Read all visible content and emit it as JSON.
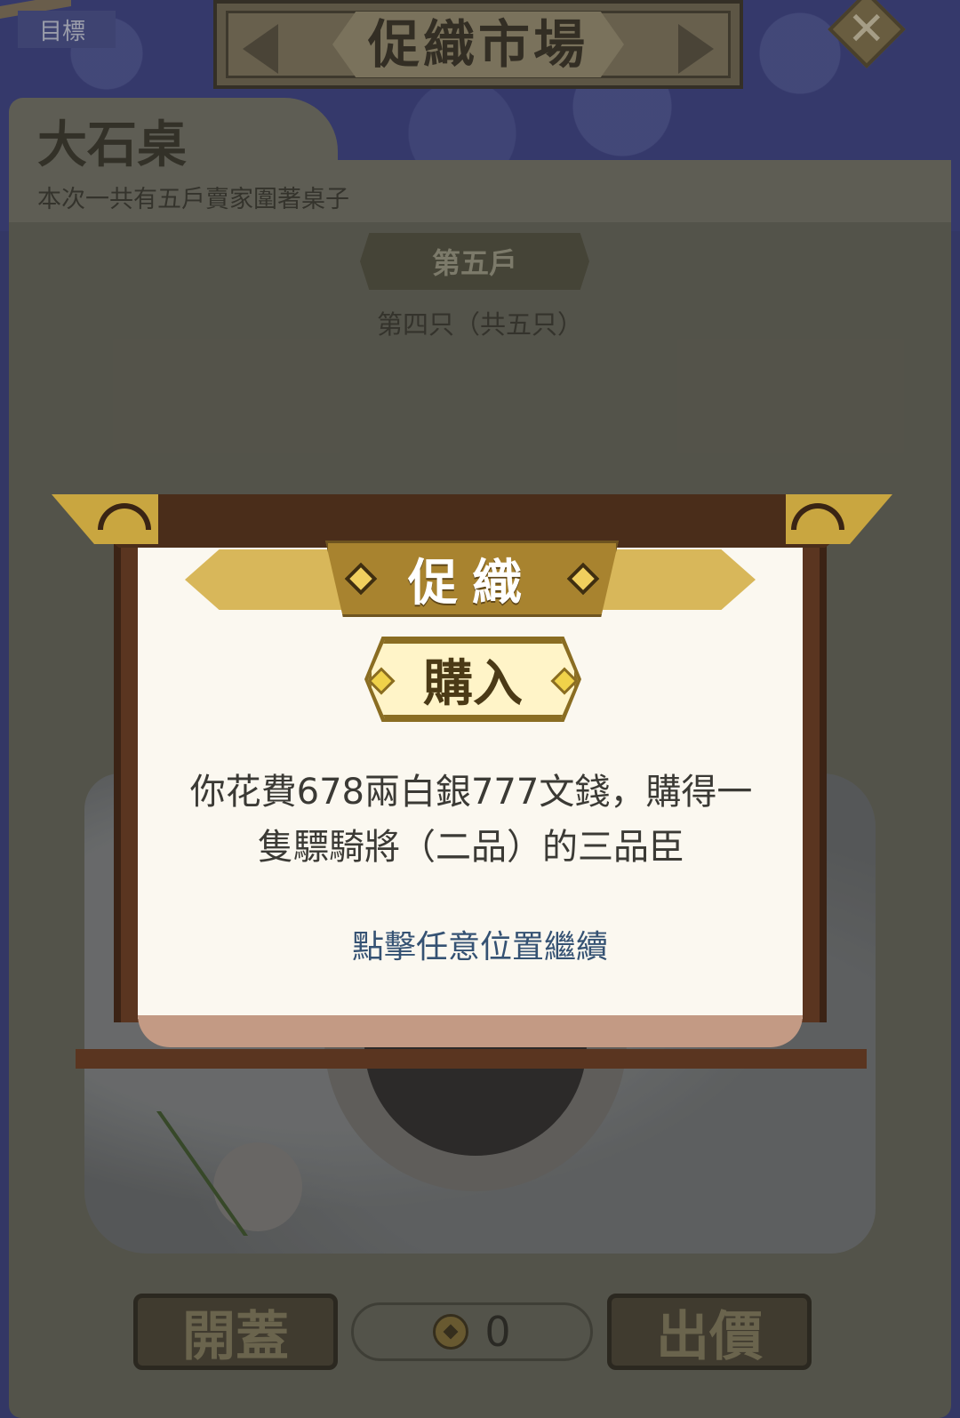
{
  "header": {
    "target_tab": "目標",
    "title": "促織市場",
    "close_glyph": "✕"
  },
  "table": {
    "name": "大石桌",
    "description": "本次一共有五戶賣家圍著桌子",
    "seller": "第五戶",
    "item_index": "第四只（共五只）"
  },
  "modal": {
    "ribbon_title": "促織",
    "result_label": "購入",
    "message_line1": "你花費678兩白銀777文錢，購得一",
    "message_line2": "隻驃騎將（二品）的三品臣",
    "continue_hint": "點擊任意位置繼續"
  },
  "bottom": {
    "open_lid_label": "開蓋",
    "bid_label": "出價",
    "coin_count": "0",
    "coin_icon": "copper-coin-icon"
  },
  "colors": {
    "background_blue": "#3d4390",
    "panel": "#6b6a5c",
    "modal_paper": "#fbf8f0",
    "gold": "#a8832f",
    "hint_blue": "#355273"
  }
}
